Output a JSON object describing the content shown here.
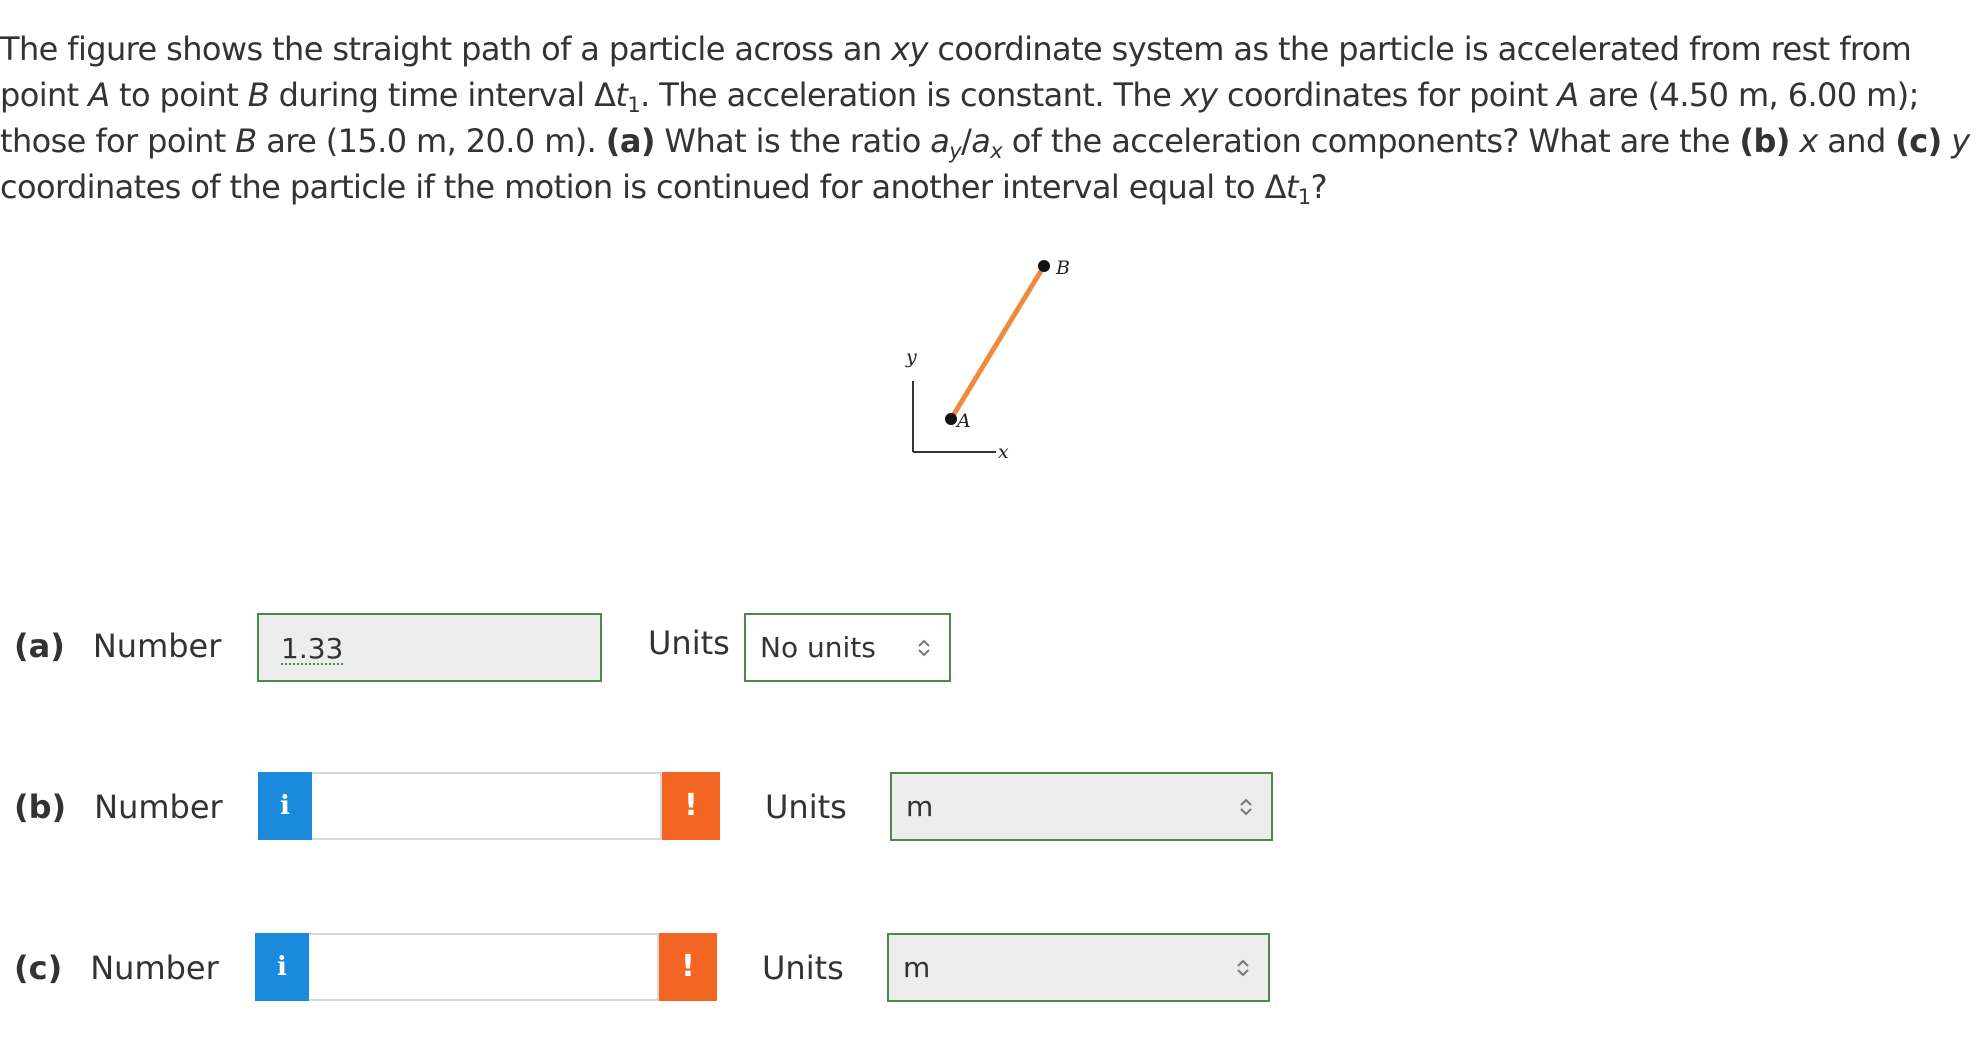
{
  "question": {
    "s1": "The figure shows the straight path of a particle across an ",
    "xy1": "xy",
    "s2": " coordinate system as the particle is accelerated from rest from point ",
    "A1": "A",
    "s3": " to point ",
    "B1": "B",
    "s4": " during time interval Δ",
    "t1": "t",
    "sub1": "1",
    "s5": ". The acceleration is constant. The ",
    "xy2": "xy",
    "s6": " coordinates for point ",
    "A2": "A",
    "s7": " are (4.50 m, 6.00 m); those for point ",
    "B2": "B",
    "s8": " are (15.0 m, 20.0 m). ",
    "pa": "(a)",
    "s9": " What is the ratio ",
    "ay": "a",
    "ay_sub": "y",
    "slash": "/",
    "ax": "a",
    "ax_sub": "x",
    "s10": " of the acceleration components? What are the ",
    "pb": "(b)",
    "x": "x",
    "s11": " and ",
    "pc": "(c)",
    "y": "y",
    "s12": " coordinates of the particle if the motion is continued for another interval equal to Δ",
    "t2": "t",
    "sub2": "1",
    "s13": "?"
  },
  "figure": {
    "label_B": "B",
    "label_A": "A",
    "label_y": "y",
    "label_x": "x",
    "path_color": "#f08a3c",
    "axis_color": "#333333"
  },
  "parts": [
    {
      "part": "(a)",
      "label": "Number",
      "value": "1.33",
      "units_label": "Units",
      "units_value": "No units"
    },
    {
      "part": "(b)",
      "label": "Number",
      "info": "i",
      "value": "",
      "warn": "!",
      "units_label": "Units",
      "units_value": "m"
    },
    {
      "part": "(c)",
      "label": "Number",
      "info": "i",
      "value": "",
      "warn": "!",
      "units_label": "Units",
      "units_value": "m"
    }
  ],
  "colors": {
    "info_blue": "#1a8bdc",
    "warn_orange": "#f26522",
    "box_border_green": "#4a8a4a"
  }
}
